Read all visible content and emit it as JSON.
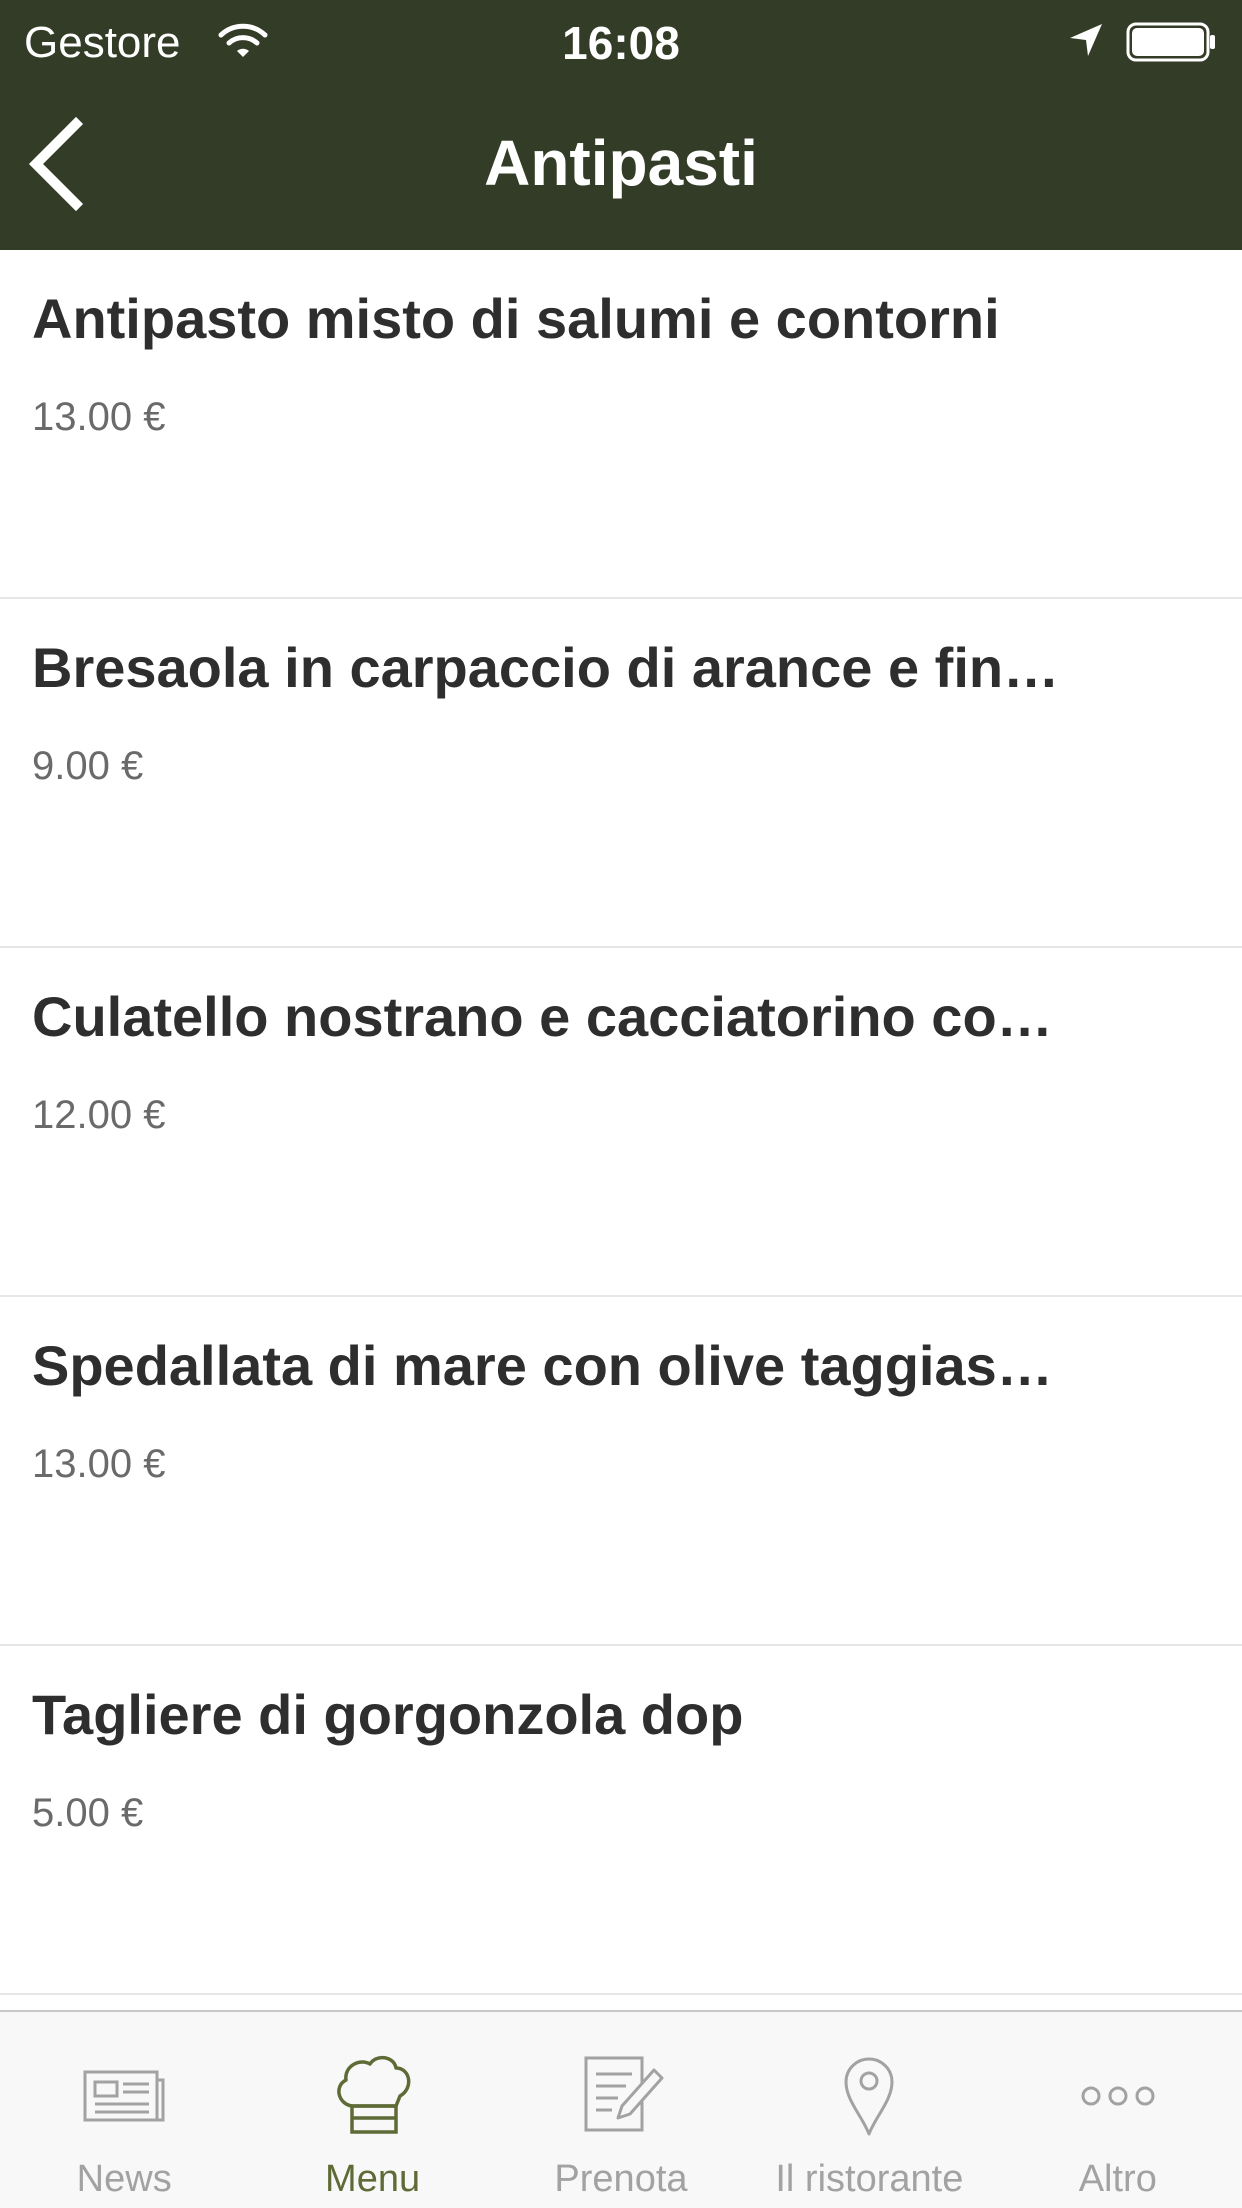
{
  "status_bar": {
    "carrier": "Gestore",
    "time": "16:08",
    "wifi_icon": "wifi-icon",
    "location_icon": "location-arrow-icon",
    "battery_icon": "battery-icon"
  },
  "nav": {
    "title": "Antipasti",
    "back_icon": "chevron-left-icon"
  },
  "menu_items": [
    {
      "name": "Antipasto misto di salumi e contorni",
      "price": "13.00 €"
    },
    {
      "name": "Bresaola in carpaccio di arance e fin…",
      "price": "9.00 €"
    },
    {
      "name": "Culatello nostrano e cacciatorino co…",
      "price": "12.00 €"
    },
    {
      "name": "Spedallata di mare con olive taggias…",
      "price": "13.00 €"
    },
    {
      "name": "Tagliere di gorgonzola dop",
      "price": "5.00 €"
    }
  ],
  "tab_bar": {
    "tabs": [
      {
        "label": "News",
        "icon": "newspaper-icon",
        "active": false
      },
      {
        "label": "Menu",
        "icon": "chef-hat-icon",
        "active": true
      },
      {
        "label": "Prenota",
        "icon": "edit-document-icon",
        "active": false
      },
      {
        "label": "Il ristorante",
        "icon": "map-pin-icon",
        "active": false
      },
      {
        "label": "Altro",
        "icon": "more-dots-icon",
        "active": false
      }
    ]
  },
  "colors": {
    "header_bg": "#323c26",
    "active_tab": "#5e6b36",
    "inactive_tab": "#a2a2a2"
  }
}
